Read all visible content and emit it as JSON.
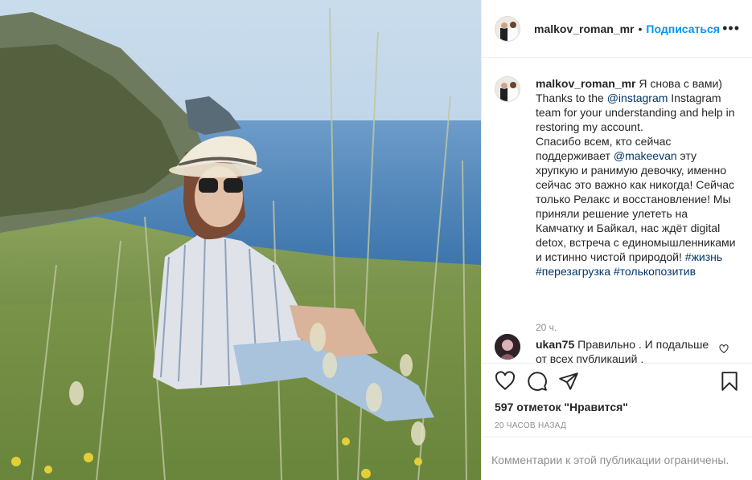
{
  "post": {
    "image_alt": "Woman in a straw hat and sunglasses sitting in tall grass above a lake",
    "colors": {
      "link": "#0095f6",
      "mention": "#00376b",
      "muted": "#8e8e8e"
    }
  },
  "header": {
    "username": "malkov_roman_mr",
    "separator": "•",
    "follow_label": "Подписаться",
    "more_icon": "more-horizontal-icon",
    "more_label": "•••"
  },
  "caption": {
    "username": "malkov_roman_mr",
    "text_1": " Я снова с вами)\nThanks to the ",
    "mention_1": "@instagram",
    "text_2": " Instagram team for your understanding and help in restoring my account.\nСпасибо всем, кто сейчас поддерживает ",
    "mention_2": "@makeevan",
    "text_3": " эту хрупкую и ранимую девочку, именно сейчас это важно как никогда! Сейчас только Релакс и восстановление! Мы приняли решение улететь на Камчатку и Байкал, нас ждёт digital detox, встреча с единомышленниками и истинно чистой природой! ",
    "tag_1": "#жизнь",
    "tag_2": "#перезагрузка",
    "tag_3": "#толькопозитив",
    "time": "20 ч."
  },
  "comment": {
    "username": "ukan75",
    "text": " Правильно . И подальше от всех публикаций .",
    "like_icon": "heart-outline-icon"
  },
  "actions": {
    "like_icon": "heart-icon",
    "comment_icon": "comment-icon",
    "share_icon": "share-icon",
    "save_icon": "bookmark-icon"
  },
  "likes_text": "597 отметок \"Нравится\"",
  "date_text": "20 часов назад",
  "footer_text": "Комментарии к этой публикации ограничены."
}
